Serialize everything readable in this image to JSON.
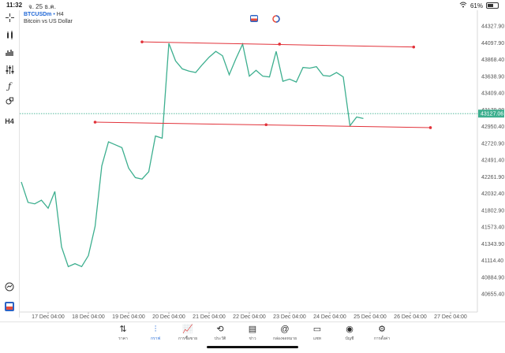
{
  "status_bar": {
    "time": "11:32",
    "date": "จ. 25 ธ.ค.",
    "battery": "61%",
    "battery_level": 0.61
  },
  "toolbar": {
    "timeframe": "H4"
  },
  "chart_header": {
    "symbol": "BTCUSDm",
    "separator": "•",
    "timeframe": "H4",
    "description": "Bitcoin vs US Dollar"
  },
  "top_icons": {
    "buy_sell_icon": "buy-sell-icon",
    "timer_icon": "timer-icon"
  },
  "current_price_label": "43127.06",
  "colors": {
    "line": "#3daf8f",
    "trendline": "#e2323a",
    "price_marker": "#3daf8f",
    "accent": "#1e66d6"
  },
  "chart_data": {
    "type": "line",
    "title": "",
    "y_ticks": [
      "44327.90",
      "44097.90",
      "43868.40",
      "43638.90",
      "43409.40",
      "43179.90",
      "42950.40",
      "42720.90",
      "42491.40",
      "42261.90",
      "42032.40",
      "41802.90",
      "41573.40",
      "41343.90",
      "41114.40",
      "40884.90",
      "40655.40"
    ],
    "ylim": [
      40655.4,
      44327.9
    ],
    "x_ticks": [
      "17 Dec 04:00",
      "18 Dec 04:00",
      "19 Dec 04:00",
      "20 Dec 04:00",
      "21 Dec 04:00",
      "22 Dec 04:00",
      "23 Dec 04:00",
      "24 Dec 04:00",
      "25 Dec 04:00",
      "26 Dec 04:00",
      "27 Dec 04:00"
    ],
    "x_tick_index": [
      4,
      10,
      16,
      22,
      28,
      34,
      40,
      46,
      52,
      58,
      64
    ],
    "series": [
      {
        "values": [
          42190,
          41910,
          41890,
          41940,
          41830,
          42060,
          41300,
          41030,
          41070,
          41030,
          41180,
          41580,
          42410,
          42740,
          42700,
          42660,
          42380,
          42250,
          42230,
          42330,
          42820,
          42790,
          44090,
          43850,
          43740,
          43710,
          43690,
          43800,
          43900,
          43980,
          43920,
          43660,
          43880,
          44080,
          43640,
          43720,
          43640,
          43630,
          43980,
          43570,
          43600,
          43560,
          43760,
          43750,
          43770,
          43650,
          43640,
          43690,
          43630,
          42960,
          43080,
          43060
        ],
        "x_start_index": 0
      }
    ],
    "trendlines": [
      {
        "points": [
          [
            18,
            44110
          ],
          [
            38.5,
            44080
          ],
          [
            58.5,
            44040
          ]
        ]
      },
      {
        "points": [
          [
            11,
            43010
          ],
          [
            36.5,
            42975
          ],
          [
            61,
            42935
          ]
        ]
      }
    ],
    "current_price": 43127.06,
    "x_count": 70,
    "grid": false
  },
  "bottom_nav": [
    {
      "label": "ราคา",
      "icon": "quotes-icon",
      "glyph": "⇅",
      "active": false
    },
    {
      "label": "กราฟ",
      "icon": "chart-candles-icon",
      "glyph": "⫶",
      "active": true
    },
    {
      "label": "การซื้อขาย",
      "icon": "trade-icon",
      "glyph": "📈",
      "active": false
    },
    {
      "label": "ประวัติ",
      "icon": "history-icon",
      "glyph": "⟲",
      "active": false
    },
    {
      "label": "ข่าว",
      "icon": "news-icon",
      "glyph": "▤",
      "active": false
    },
    {
      "label": "กล่องจดหมาย",
      "icon": "mailbox-icon",
      "glyph": "@",
      "active": false
    },
    {
      "label": "แชท",
      "icon": "chat-icon",
      "glyph": "▭",
      "active": false
    },
    {
      "label": "บัญชี",
      "icon": "account-icon",
      "glyph": "◉",
      "active": false
    },
    {
      "label": "การตั้งค่า",
      "icon": "settings-icon",
      "glyph": "⚙",
      "active": false
    }
  ]
}
